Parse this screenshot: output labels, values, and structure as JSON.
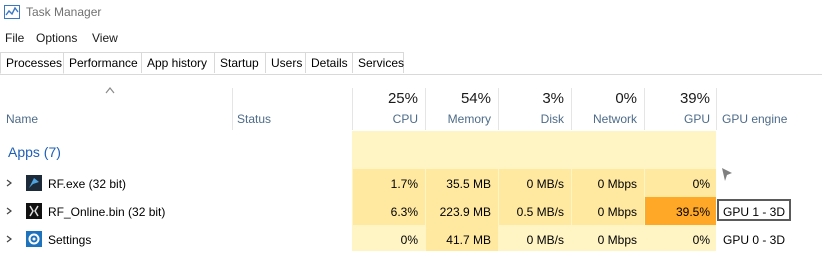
{
  "window": {
    "title": "Task Manager"
  },
  "menu": {
    "items": [
      "File",
      "Options",
      "View"
    ]
  },
  "tabs": [
    "Processes",
    "Performance",
    "App history",
    "Startup",
    "Users",
    "Details",
    "Services"
  ],
  "active_tab": "Processes",
  "columns": {
    "name": "Name",
    "status": "Status",
    "cpu": {
      "label": "CPU",
      "total": "25%"
    },
    "memory": {
      "label": "Memory",
      "total": "54%"
    },
    "disk": {
      "label": "Disk",
      "total": "3%"
    },
    "network": {
      "label": "Network",
      "total": "0%"
    },
    "gpu": {
      "label": "GPU",
      "total": "39%"
    },
    "gpu_engine": "GPU engine"
  },
  "group": {
    "title": "Apps (7)"
  },
  "rows": [
    {
      "name": "RF.exe (32 bit)",
      "cpu": "1.7%",
      "memory": "35.5 MB",
      "disk": "0 MB/s",
      "network": "0 Mbps",
      "gpu": "0%",
      "gpu_engine": ""
    },
    {
      "name": "RF_Online.bin (32 bit)",
      "cpu": "6.3%",
      "memory": "223.9 MB",
      "disk": "0.5 MB/s",
      "network": "0 Mbps",
      "gpu": "39.5%",
      "gpu_engine": "GPU 1 - 3D"
    },
    {
      "name": "Settings",
      "cpu": "0%",
      "memory": "41.7 MB",
      "disk": "0 MB/s",
      "network": "0 Mbps",
      "gpu": "0%",
      "gpu_engine": "GPU 0 - 3D"
    }
  ],
  "colors": {
    "column_fill": "#fff4c4",
    "cell_fill": "#ffe9a1",
    "gpu_hot": "#ffa726",
    "group_title": "#1f5fb7",
    "header_label": "#4d6b89"
  }
}
